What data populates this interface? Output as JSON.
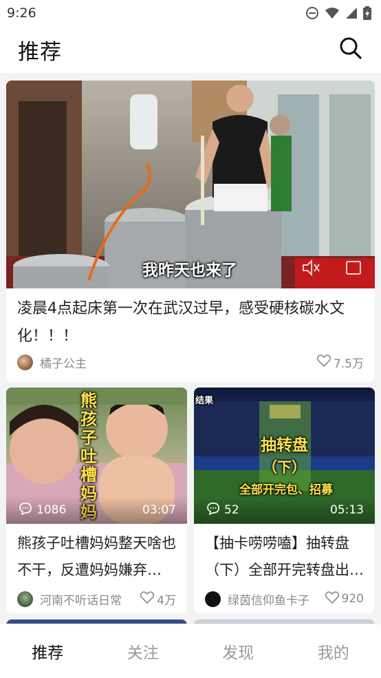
{
  "status": {
    "time": "9:26"
  },
  "header": {
    "title": "推荐"
  },
  "feed": {
    "featured": {
      "title": "凌晨4点起床第一次在武汉过早，感受硬核碳水文化！！！",
      "overlay": "我昨天也来了",
      "author": "橘子公主",
      "likes": "7.5万"
    },
    "left": {
      "title": "熊孩子吐槽妈妈整天啥也不干，反遭妈妈嫌弃…",
      "overlay": "熊孩子吐槽妈妈",
      "comments": "1086",
      "duration": "03:07",
      "author": "河南不听话日常",
      "likes": "4万"
    },
    "right": {
      "title": "【抽卡唠唠嗑】抽转盘（下）全部开完转盘出…",
      "overlay_1": "抽转盘",
      "overlay_2": "（下）",
      "overlay_3": "全部开完包、招募",
      "corner_text": "结果",
      "comments": "52",
      "duration": "05:13",
      "author": "绿茵信仰鱼卡子",
      "likes": "920"
    }
  },
  "nav": {
    "items": [
      "推荐",
      "关注",
      "发现",
      "我的"
    ]
  },
  "colors": {
    "active": "#111111",
    "inactive": "#999999"
  }
}
